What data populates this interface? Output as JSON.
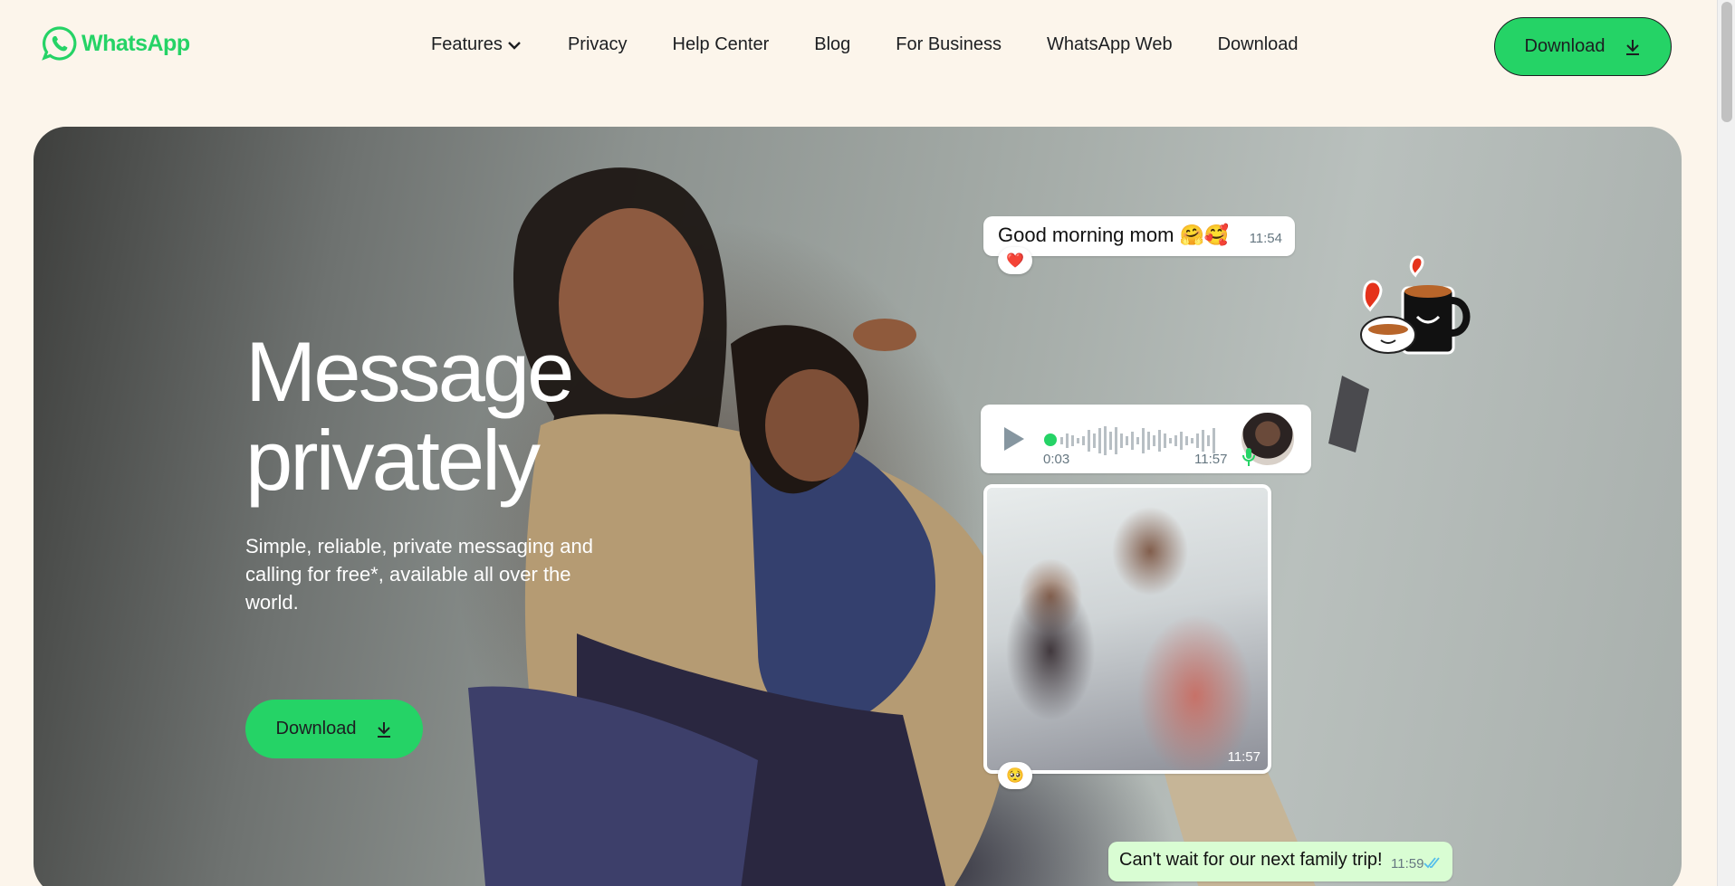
{
  "header": {
    "logo_text": "WhatsApp",
    "nav": [
      "Features",
      "Privacy",
      "Help Center",
      "Blog",
      "For Business",
      "WhatsApp Web",
      "Download"
    ],
    "download_label": "Download"
  },
  "hero": {
    "title_line1": "Message",
    "title_line2": "privately",
    "subtitle": "Simple, reliable, private messaging and calling for free*, available all over the world.",
    "download_label": "Download"
  },
  "chat": {
    "msg1_text": "Good morning mom 🤗🥰",
    "msg1_time": "11:54",
    "msg1_reaction": "❤️",
    "voice_duration": "0:03",
    "voice_time": "11:57",
    "photo_time": "11:57",
    "photo_reaction": "🥺",
    "msg2_text": "Can't wait for our next family trip!",
    "msg2_time": "11:59"
  },
  "colors": {
    "brand_green": "#25d366",
    "background": "#fcf5eb",
    "outgoing_bubble": "#d9fdd3"
  },
  "icons": [
    "whatsapp-logo-icon",
    "chevron-down-icon",
    "download-arrow-icon",
    "play-icon",
    "mic-icon",
    "double-check-icon",
    "heart-icon"
  ]
}
